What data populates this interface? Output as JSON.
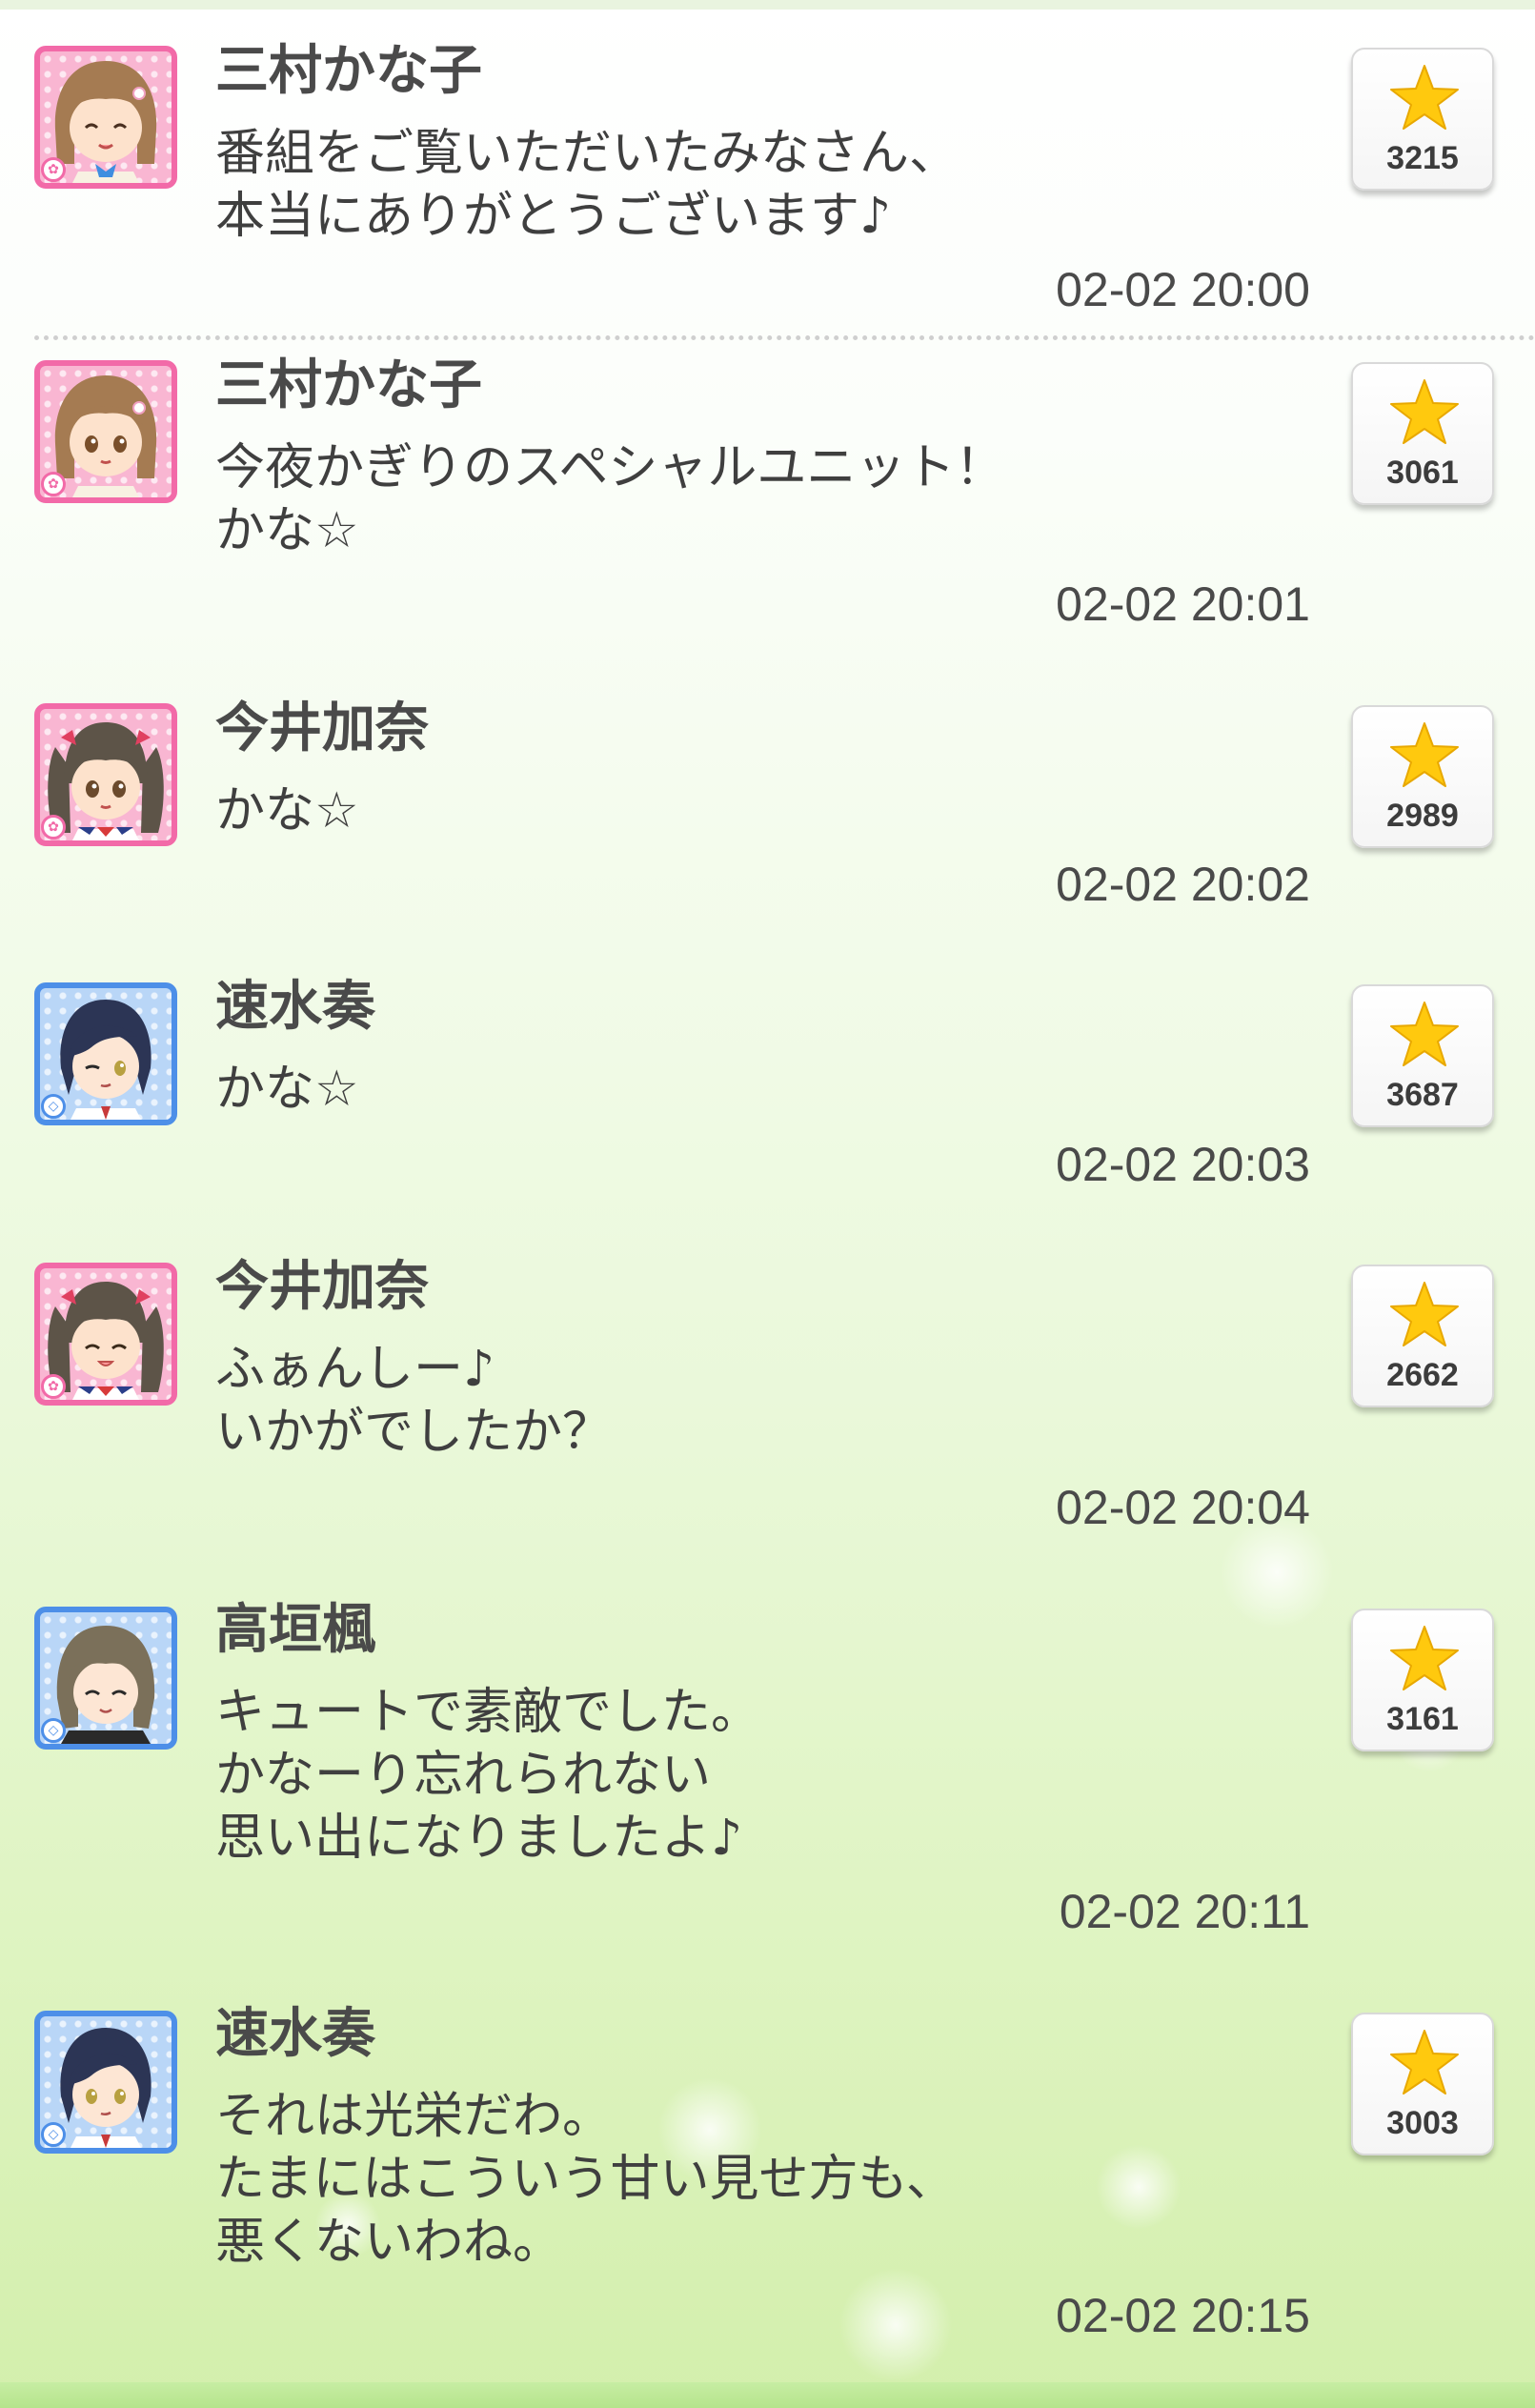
{
  "colors": {
    "pink_attribute": "#f26aa8",
    "blue_attribute": "#4d8fe8",
    "star": "#ffc90e",
    "background_bottom": "#d3efac"
  },
  "posts": [
    {
      "author": "三村かな子",
      "message": "番組をご覧いただいたみなさん、\n本当にありがとうございます♪",
      "time": "02-02 20:00",
      "likes": "3215",
      "avatar_icon": "kanako-avatar-icon",
      "attribute": "cute"
    },
    {
      "author": "三村かな子",
      "message": "今夜かぎりのスペシャルユニット！\nかな☆",
      "time": "02-02 20:01",
      "likes": "3061",
      "avatar_icon": "kanako-avatar-icon",
      "attribute": "cute"
    },
    {
      "author": "今井加奈",
      "message": "かな☆",
      "time": "02-02 20:02",
      "likes": "2989",
      "avatar_icon": "kana-avatar-icon",
      "attribute": "cute"
    },
    {
      "author": "速水奏",
      "message": "かな☆",
      "time": "02-02 20:03",
      "likes": "3687",
      "avatar_icon": "kanade-avatar-icon",
      "attribute": "cool"
    },
    {
      "author": "今井加奈",
      "message": "ふぁんしー♪\nいかがでしたか？",
      "time": "02-02 20:04",
      "likes": "2662",
      "avatar_icon": "kana-avatar-icon",
      "attribute": "cute"
    },
    {
      "author": "高垣楓",
      "message": "キュートで素敵でした。\nかなーり忘れられない\n思い出になりましたよ♪",
      "time": "02-02 20:11",
      "likes": "3161",
      "avatar_icon": "kaede-avatar-icon",
      "attribute": "cool"
    },
    {
      "author": "速水奏",
      "message": "それは光栄だわ。\nたまにはこういう甘い見せ方も、\n悪くないわね。",
      "time": "02-02 20:15",
      "likes": "3003",
      "avatar_icon": "kanade-avatar-icon",
      "attribute": "cool"
    }
  ]
}
